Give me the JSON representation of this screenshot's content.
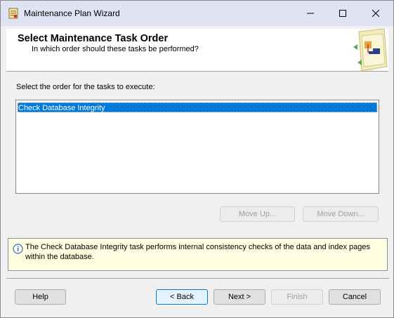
{
  "window": {
    "title": "Maintenance Plan Wizard"
  },
  "header": {
    "title": "Select Maintenance Task Order",
    "subtitle": "In which order should these tasks be performed?"
  },
  "body": {
    "instruction": "Select the order for the tasks to execute:",
    "tasks": [
      "Check Database Integrity"
    ],
    "move_up_label": "Move Up...",
    "move_down_label": "Move Down..."
  },
  "info": {
    "text": "The Check Database Integrity task performs internal consistency checks of the data and index pages within the database."
  },
  "footer": {
    "help_label": "Help",
    "back_label": "< Back",
    "next_label": "Next >",
    "finish_label": "Finish",
    "cancel_label": "Cancel"
  },
  "icons": {
    "app": "maintenance-plan-icon",
    "header": "wizard-graphic-icon",
    "info": "info-icon"
  },
  "colors": {
    "title_bar": "#dfe3f3",
    "selection": "#0078d7",
    "info_background": "#ffffe1"
  }
}
